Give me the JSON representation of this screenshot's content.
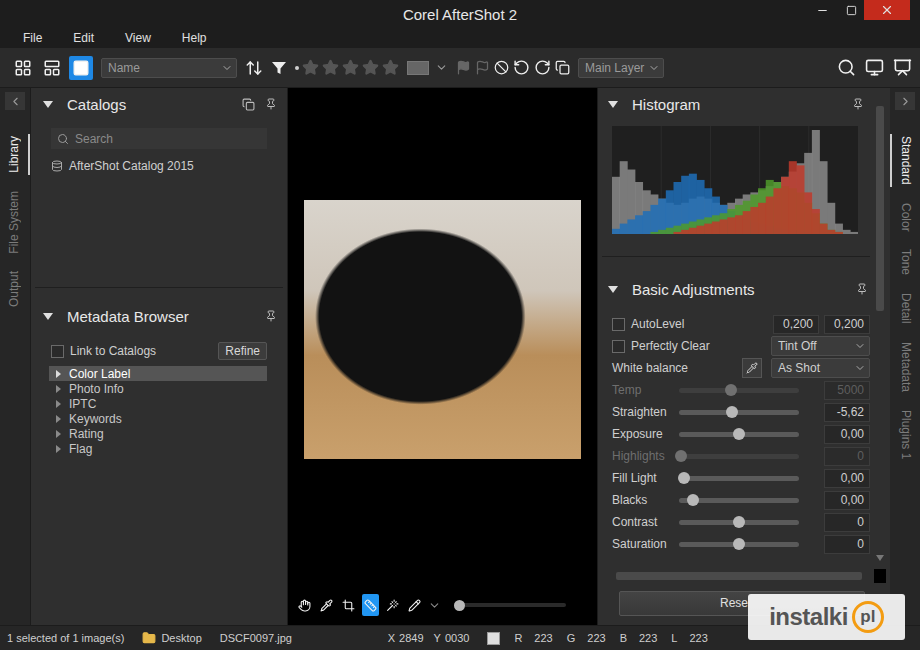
{
  "window": {
    "title": "Corel AfterShot 2"
  },
  "menu": [
    {
      "label": "File"
    },
    {
      "label": "Edit"
    },
    {
      "label": "View"
    },
    {
      "label": "Help"
    }
  ],
  "toolbar": {
    "view_modes": [
      {
        "selected": false
      },
      {
        "selected": false
      },
      {
        "selected": true
      }
    ],
    "sort_field": "Name",
    "rating": {
      "stars": 0
    },
    "layer": "Main Layer"
  },
  "left_tabs": [
    {
      "label": "Library",
      "selected": true
    },
    {
      "label": "File System",
      "selected": false
    },
    {
      "label": "Output",
      "selected": false
    }
  ],
  "catalogs": {
    "title": "Catalogs",
    "expanded": true,
    "search_placeholder": "Search",
    "items": [
      {
        "label": "AfterShot Catalog 2015"
      }
    ]
  },
  "metadata_browser": {
    "title": "Metadata Browser",
    "expanded": true,
    "link": {
      "label": "Link to Catalogs",
      "checked": false
    },
    "refine": "Refine",
    "tree": [
      {
        "label": "Color Label",
        "expanded": false,
        "selected": true
      },
      {
        "label": "Photo Info",
        "expanded": false,
        "selected": false
      },
      {
        "label": "IPTC",
        "expanded": false,
        "selected": false
      },
      {
        "label": "Keywords",
        "expanded": false,
        "selected": false
      },
      {
        "label": "Rating",
        "expanded": false,
        "selected": false
      },
      {
        "label": "Flag",
        "expanded": false,
        "selected": false
      }
    ]
  },
  "viewer": {
    "tools": [
      {
        "selected": false
      },
      {
        "selected": false
      },
      {
        "selected": false
      },
      {
        "selected": true
      },
      {
        "selected": false
      },
      {
        "selected": false
      }
    ],
    "zoom": {
      "level": 0.05
    }
  },
  "histogram": {
    "title": "Histogram",
    "expanded": true,
    "series": [
      {
        "color": "#9a9a9a",
        "values": [
          55,
          70,
          62,
          50,
          42,
          38,
          34,
          30,
          28,
          30,
          34,
          36,
          34,
          30,
          28,
          30,
          34,
          38,
          40,
          42,
          46,
          50,
          55,
          60,
          68,
          78,
          100,
          70,
          30,
          10,
          4,
          2
        ]
      },
      {
        "color": "#1f6fb8",
        "values": [
          5,
          10,
          14,
          18,
          22,
          28,
          34,
          42,
          50,
          56,
          58,
          52,
          44,
          36,
          28,
          22,
          18,
          14,
          12,
          10,
          8,
          6,
          5,
          4,
          3,
          2,
          1,
          0,
          0,
          0,
          0,
          0
        ]
      },
      {
        "color": "#4f9a2a",
        "values": [
          0,
          0,
          0,
          0,
          0,
          2,
          4,
          6,
          8,
          10,
          12,
          14,
          16,
          18,
          20,
          24,
          28,
          32,
          38,
          44,
          52,
          50,
          46,
          44,
          40,
          30,
          20,
          10,
          4,
          2,
          0,
          0
        ]
      },
      {
        "color": "#c0392b",
        "values": [
          0,
          0,
          0,
          0,
          0,
          0,
          0,
          0,
          2,
          4,
          6,
          8,
          10,
          12,
          14,
          16,
          18,
          22,
          26,
          30,
          36,
          44,
          55,
          70,
          66,
          40,
          24,
          10,
          4,
          2,
          0,
          0
        ]
      }
    ]
  },
  "adjustments": {
    "title": "Basic Adjustments",
    "expanded": true,
    "rows": [
      {
        "kind": "check",
        "label": "AutoLevel",
        "checked": false,
        "values": [
          "0,200",
          "0,200"
        ]
      },
      {
        "kind": "check",
        "label": "Perfectly Clear",
        "checked": false,
        "dropdown": "Tint Off"
      },
      {
        "kind": "wb",
        "label": "White balance",
        "dropdown": "As Shot"
      },
      {
        "kind": "slider",
        "label": "Temp",
        "level": 0.43,
        "value": "5000",
        "disabled": true
      },
      {
        "kind": "slider",
        "label": "Straighten",
        "level": 0.44,
        "value": "-5,62",
        "disabled": false
      },
      {
        "kind": "slider",
        "label": "Exposure",
        "level": 0.5,
        "value": "0,00",
        "disabled": false
      },
      {
        "kind": "slider",
        "label": "Highlights",
        "level": 0.02,
        "value": "0",
        "disabled": true
      },
      {
        "kind": "slider",
        "label": "Fill Light",
        "level": 0.04,
        "value": "0,00",
        "disabled": false
      },
      {
        "kind": "slider",
        "label": "Blacks",
        "level": 0.12,
        "value": "0,00",
        "disabled": false
      },
      {
        "kind": "slider",
        "label": "Contrast",
        "level": 0.5,
        "value": "0",
        "disabled": false
      },
      {
        "kind": "slider",
        "label": "Saturation",
        "level": 0.5,
        "value": "0",
        "disabled": false
      }
    ],
    "reset": "Rese"
  },
  "right_tabs": [
    {
      "label": "Standard",
      "selected": true
    },
    {
      "label": "Color",
      "selected": false
    },
    {
      "label": "Tone",
      "selected": false
    },
    {
      "label": "Detail",
      "selected": false
    },
    {
      "label": "Metadata",
      "selected": false
    },
    {
      "label": "Plugins 1",
      "selected": false
    }
  ],
  "status_bar": {
    "selection": "1 selected of 1 image(s)",
    "folder": "Desktop",
    "file": "DSCF0097.jpg",
    "coords": [
      {
        "label": "X",
        "value": "2849"
      },
      {
        "label": "Y",
        "value": "0030"
      }
    ],
    "channels": [
      {
        "label": "R",
        "value": "223"
      },
      {
        "label": "G",
        "value": "223"
      },
      {
        "label": "B",
        "value": "223"
      },
      {
        "label": "L",
        "value": "223"
      }
    ]
  },
  "watermark": {
    "text": "instalki",
    "badge": "pl"
  }
}
